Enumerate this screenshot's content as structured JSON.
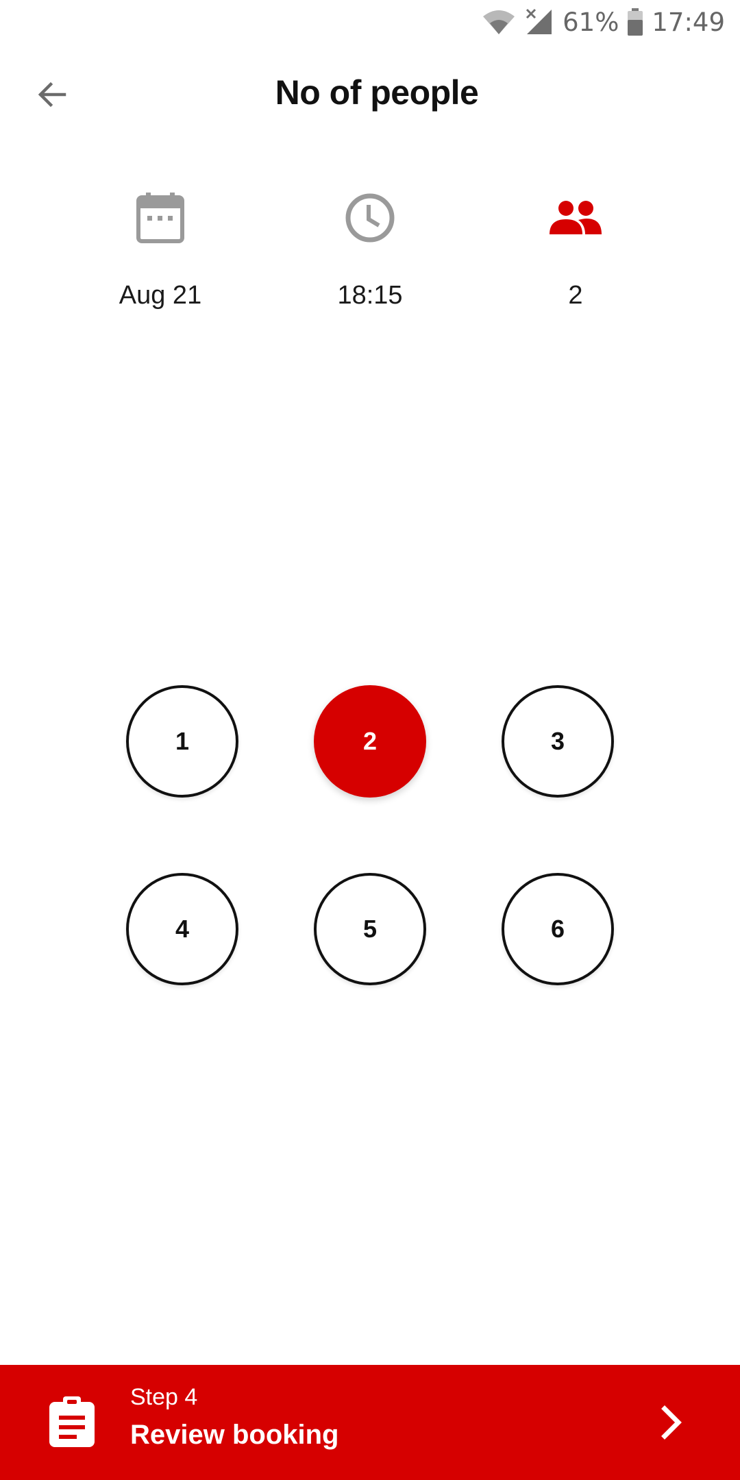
{
  "status_bar": {
    "battery_percent": "61%",
    "time": "17:49",
    "icons": [
      "wifi-icon",
      "signal-icon",
      "battery-icon"
    ]
  },
  "header": {
    "title": "No of people",
    "back_icon": "arrow-left-icon"
  },
  "summary": {
    "date": {
      "icon": "calendar-icon",
      "value": "Aug 21"
    },
    "time": {
      "icon": "clock-icon",
      "value": "18:15"
    },
    "people": {
      "icon": "people-icon",
      "value": "2"
    }
  },
  "people_options": {
    "options": [
      "1",
      "2",
      "3",
      "4",
      "5",
      "6"
    ],
    "selected": "2"
  },
  "footer": {
    "step_label": "Step 4",
    "action_label": "Review booking",
    "icon": "clipboard-icon",
    "arrow_icon": "chevron-right-icon"
  },
  "colors": {
    "accent": "#d60000",
    "icon_gray": "#9a9a9a",
    "text": "#111111"
  }
}
